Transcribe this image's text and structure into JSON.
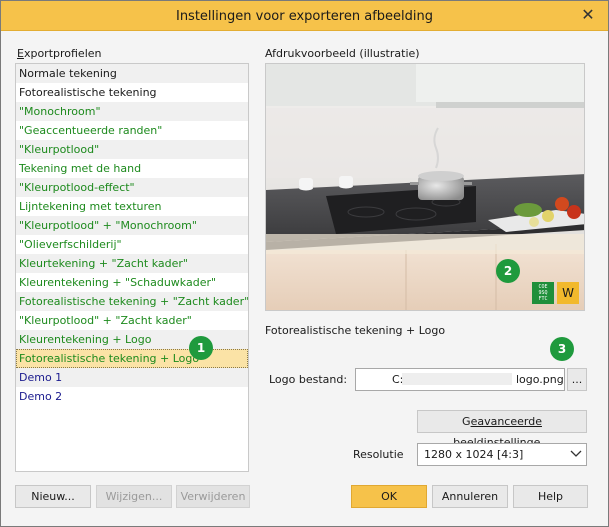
{
  "window": {
    "title": "Instellingen voor exporteren afbeelding",
    "close_glyph": "✕"
  },
  "profiles": {
    "label_underline_char": "E",
    "label_rest": "xportprofielen",
    "items": [
      {
        "label": "Normale tekening",
        "color": "#1a1a1a"
      },
      {
        "label": "Fotorealistische tekening",
        "color": "#1a1a1a"
      },
      {
        "label": "\"Monochroom\"",
        "color": "#1d8a1d"
      },
      {
        "label": "\"Geaccentueerde randen\"",
        "color": "#1d8a1d"
      },
      {
        "label": "\"Kleurpotlood\"",
        "color": "#1d8a1d"
      },
      {
        "label": "Tekening met de hand",
        "color": "#1d8a1d"
      },
      {
        "label": "\"Kleurpotlood-effect\"",
        "color": "#1d8a1d"
      },
      {
        "label": "Lijntekening met texturen",
        "color": "#1d8a1d"
      },
      {
        "label": "\"Kleurpotlood\" + \"Monochroom\"",
        "color": "#1d8a1d"
      },
      {
        "label": "\"Olieverfschilderij\"",
        "color": "#1d8a1d"
      },
      {
        "label": "Kleurtekening + \"Zacht kader\"",
        "color": "#1d8a1d"
      },
      {
        "label": "Kleurentekening + \"Schaduwkader\"",
        "color": "#1d8a1d"
      },
      {
        "label": "Fotorealistische tekening + \"Zacht kader\"",
        "color": "#1d8a1d"
      },
      {
        "label": "\"Kleurpotlood\" + \"Zacht kader\"",
        "color": "#1d8a1d"
      },
      {
        "label": "Kleurentekening + Logo",
        "color": "#1d8a1d"
      },
      {
        "label": "Fotorealistische tekening + Logo",
        "color": "#1d8a1d"
      },
      {
        "label": "Demo 1",
        "color": "#1a1a8e"
      },
      {
        "label": "Demo 2",
        "color": "#1a1a8e"
      }
    ],
    "selected_index": 15,
    "buttons": {
      "new": "Nieuw...",
      "edit": "Wijzigen...",
      "delete": "Verwijderen"
    }
  },
  "preview": {
    "label": "Afdrukvoorbeeld (illustratie)",
    "caption": "Fotorealistische tekening + Logo",
    "logo_green_text": [
      "COE",
      "9SQ",
      "FTC"
    ],
    "logo_yellow_text": "W"
  },
  "badges": {
    "one": "1",
    "two": "2",
    "three": "3"
  },
  "logo_file": {
    "label": "Logo bestand:",
    "prefix": "C:",
    "suffix": "logo.png",
    "browse": "..."
  },
  "advanced_button": {
    "part1": "G",
    "part2": "eavanceerde ",
    "part3_ul": "b",
    "part4": "eeldinstellinge..."
  },
  "resolution": {
    "label": "Resolutie",
    "value": "1280 x 1024 [4:3]"
  },
  "footer": {
    "ok": "OK",
    "cancel": "Annuleren",
    "help": "Help"
  },
  "colors": {
    "accent": "#f6c24a",
    "badge": "#1f9a3d"
  }
}
